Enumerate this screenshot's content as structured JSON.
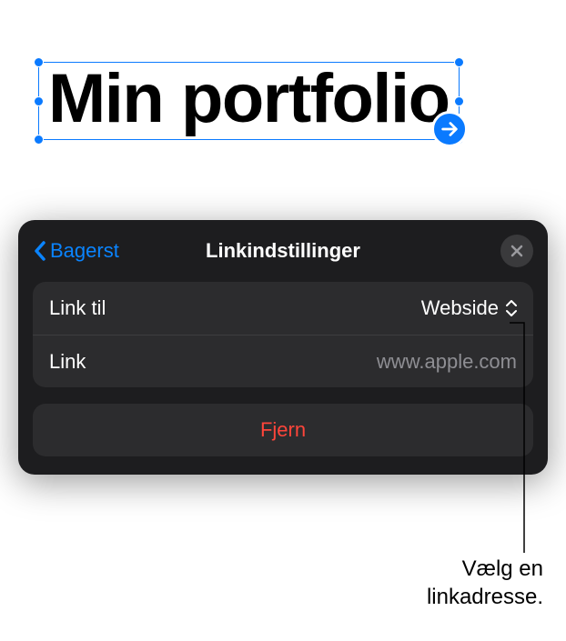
{
  "canvas": {
    "title_text": "Min portfolio"
  },
  "popover": {
    "back_label": "Bagerst",
    "title": "Linkindstillinger",
    "rows": {
      "link_to": {
        "label": "Link til",
        "value": "Webside"
      },
      "link": {
        "label": "Link",
        "placeholder": "www.apple.com"
      }
    },
    "remove_label": "Fjern"
  },
  "callout": {
    "line1": "Vælg en",
    "line2": "linkadresse."
  }
}
